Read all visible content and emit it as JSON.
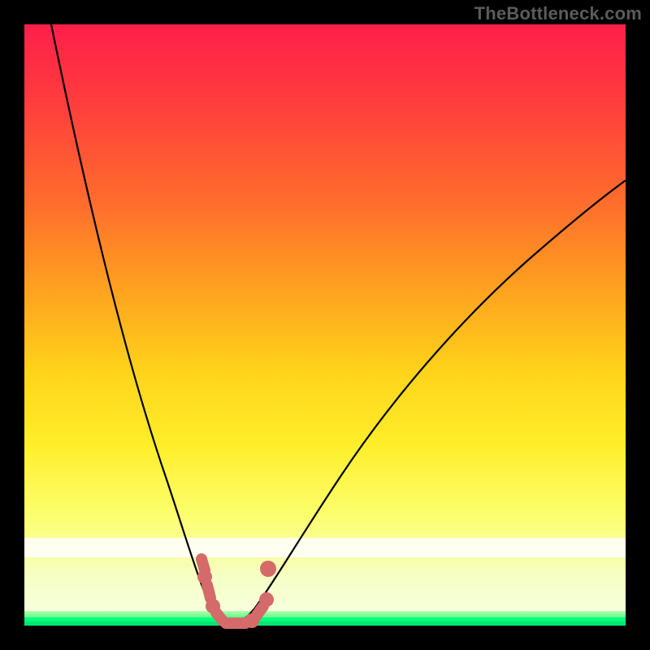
{
  "watermark": "TheBottleneck.com",
  "colors": {
    "background": "#000000",
    "gradient_top": "#ff1f4b",
    "gradient_mid": "#ffd41a",
    "gradient_bottom": "#f6ffe6",
    "green_band": "#00ff7f",
    "curve": "#000000",
    "marker": "#d46a6a",
    "watermark_text": "#5b5b5b"
  },
  "chart_data": {
    "type": "line",
    "title": "",
    "xlabel": "",
    "ylabel": "",
    "xlim": [
      0,
      100
    ],
    "ylim": [
      0,
      100
    ],
    "series": [
      {
        "name": "left-branch",
        "x": [
          4,
          6,
          8,
          10,
          12,
          14,
          16,
          18,
          20,
          22,
          24,
          26,
          28,
          29,
          30,
          31,
          32
        ],
        "y": [
          100,
          92,
          84,
          76,
          68,
          60,
          52,
          44,
          36,
          28,
          20,
          13,
          7,
          4,
          2,
          1,
          0
        ]
      },
      {
        "name": "right-branch",
        "x": [
          32,
          34,
          36,
          38,
          41,
          45,
          50,
          55,
          60,
          66,
          72,
          80,
          88,
          96,
          100
        ],
        "y": [
          0,
          1,
          3,
          6,
          10,
          16,
          24,
          31,
          38,
          45,
          52,
          60,
          67,
          73,
          76
        ]
      }
    ],
    "markers": {
      "name": "highlight-dots",
      "color": "#d46a6a",
      "points": [
        {
          "x": 28.5,
          "y": 12
        },
        {
          "x": 29,
          "y": 9
        },
        {
          "x": 29.3,
          "y": 7
        },
        {
          "x": 29.8,
          "y": 4
        },
        {
          "x": 30.5,
          "y": 2
        },
        {
          "x": 31.5,
          "y": 0.5
        },
        {
          "x": 33,
          "y": 0.2
        },
        {
          "x": 34.5,
          "y": 0.5
        },
        {
          "x": 36,
          "y": 1.5
        },
        {
          "x": 37.5,
          "y": 3
        },
        {
          "x": 38.5,
          "y": 10
        }
      ]
    },
    "bands": [
      {
        "name": "white-band",
        "y_from": 12,
        "y_to": 15,
        "color": "#ffffff"
      },
      {
        "name": "green-band",
        "y_from": 0,
        "y_to": 2.5,
        "color": "#00ff7f"
      }
    ]
  }
}
